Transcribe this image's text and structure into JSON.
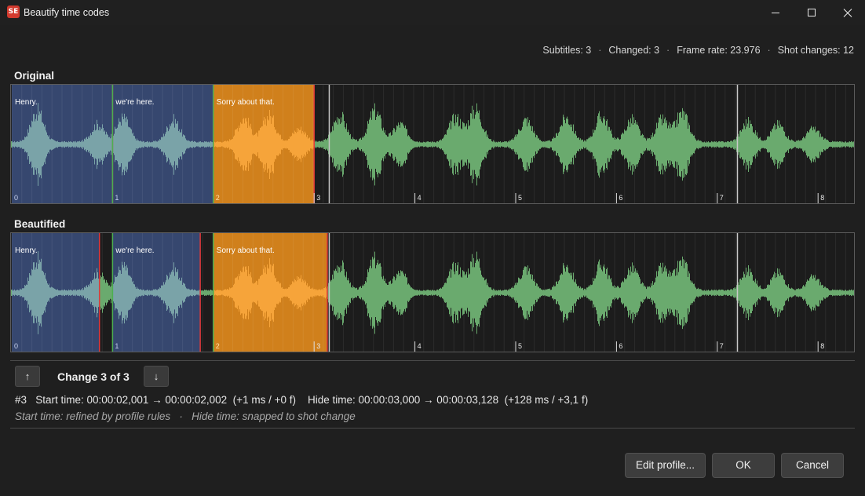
{
  "window": {
    "title": "Beautify time codes",
    "app_icon_text": "SE",
    "icons": {
      "app": "subtitle-edit-icon",
      "minimize": "minimize-icon",
      "maximize": "maximize-icon",
      "close": "close-icon"
    }
  },
  "stats": {
    "subtitles": "Subtitles: 3",
    "changed": "Changed: 3",
    "frame_rate": "Frame rate: 23.976",
    "shot_changes": "Shot changes: 12",
    "separator": "·"
  },
  "original": {
    "label": "Original",
    "subtitles": [
      {
        "index_label": "0",
        "text": "Henry.",
        "start": 0.0,
        "end": 1.0,
        "kind": "normal",
        "changed": false
      },
      {
        "index_label": "1",
        "text": "we're here.",
        "start": 1.0,
        "end": 2.0,
        "kind": "normal",
        "changed": false
      },
      {
        "index_label": "2",
        "text": "Sorry about that.",
        "start": 2.0,
        "end": 3.0,
        "kind": "current",
        "changed": true
      }
    ],
    "shot_changes": [
      3.15,
      7.2
    ]
  },
  "beautified": {
    "label": "Beautified",
    "subtitles": [
      {
        "index_label": "0",
        "text": "Henry.",
        "start": 0.0,
        "end": 0.87,
        "kind": "normal",
        "changed": true
      },
      {
        "index_label": "1",
        "text": "we're here.",
        "start": 1.0,
        "end": 1.87,
        "kind": "normal",
        "changed": true
      },
      {
        "index_label": "2",
        "text": "Sorry about that.",
        "start": 2.0,
        "end": 3.13,
        "kind": "current",
        "changed": true
      }
    ],
    "shot_changes": [
      3.15,
      7.2
    ]
  },
  "timeline": {
    "seconds_labels": [
      "0",
      "1",
      "2",
      "3",
      "4",
      "5",
      "6",
      "7",
      "8"
    ],
    "start": 0,
    "end": 8.4
  },
  "colors": {
    "subtitle_fill": "#3b4f7e",
    "current_fill": "#f0921c",
    "waveform": "#6aaa6e",
    "subtitle_waveform": "#7aa3a8",
    "current_waveform": "#f6a43a",
    "shot_change": "#c8c8c8",
    "start_marker": "#4caf50",
    "end_marker": "#e0383a"
  },
  "navigation": {
    "prev_icon": "arrow-up-icon",
    "prev_glyph": "↑",
    "next_icon": "arrow-down-icon",
    "next_glyph": "↓",
    "counter": "Change 3 of 3"
  },
  "detail": {
    "line": "#3   Start time: 00:00:02,001 → 00:00:02,002  (+1 ms / +0 f)    Hide time: 00:00:03,000 → 00:00:03,128  (+128 ms / +3,1 f)",
    "note": "Start time: refined by profile rules   ·   Hide time: snapped to shot change"
  },
  "buttons": {
    "edit_profile": "Edit profile...",
    "ok": "OK",
    "cancel": "Cancel"
  }
}
